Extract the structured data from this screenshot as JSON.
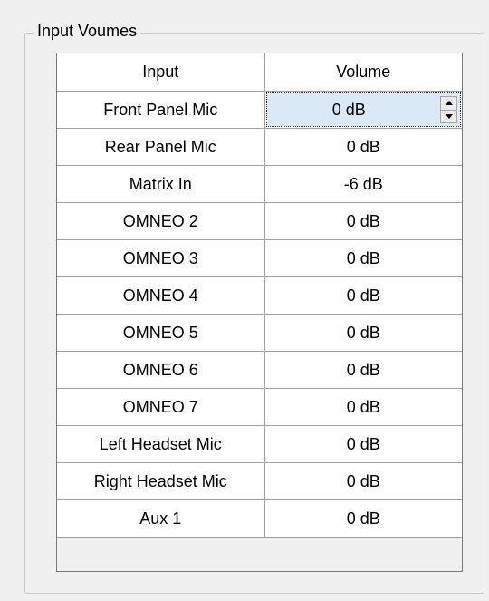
{
  "group": {
    "title": "Input Voumes"
  },
  "table": {
    "columns": [
      "Input",
      "Volume"
    ],
    "rows": [
      {
        "input": "Front Panel Mic",
        "volume": "0 dB"
      },
      {
        "input": "Rear Panel Mic",
        "volume": "0 dB"
      },
      {
        "input": "Matrix In",
        "volume": "-6 dB"
      },
      {
        "input": "OMNEO 2",
        "volume": "0 dB"
      },
      {
        "input": "OMNEO 3",
        "volume": "0 dB"
      },
      {
        "input": "OMNEO 4",
        "volume": "0 dB"
      },
      {
        "input": "OMNEO 5",
        "volume": "0 dB"
      },
      {
        "input": "OMNEO 6",
        "volume": "0 dB"
      },
      {
        "input": "OMNEO 7",
        "volume": "0 dB"
      },
      {
        "input": "Left Headset Mic",
        "volume": "0 dB"
      },
      {
        "input": "Right Headset Mic",
        "volume": "0 dB"
      },
      {
        "input": "Aux 1",
        "volume": "0 dB"
      }
    ],
    "selected_row": 0
  },
  "icons": {
    "spin_up": "triangle-up-icon",
    "spin_down": "triangle-down-icon"
  },
  "colors": {
    "selected_cell": "#dbe8f5",
    "grid_line": "#a0a0a0",
    "panel_background": "#f0f0f0"
  }
}
